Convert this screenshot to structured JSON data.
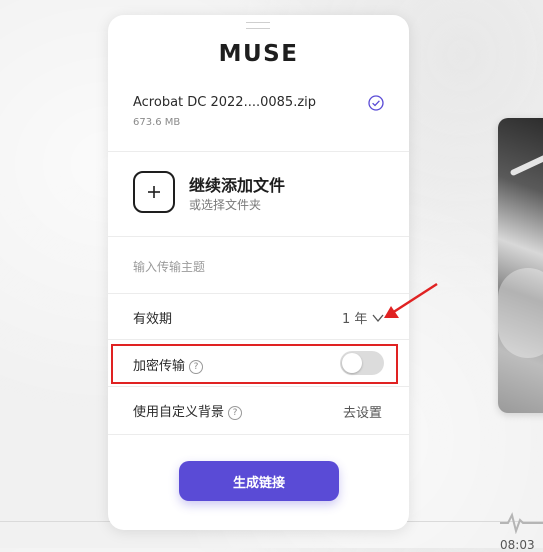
{
  "app": {
    "brand": "MUSE"
  },
  "file": {
    "name": "Acrobat DC 2022....0085.zip",
    "size": "673.6 MB",
    "status_icon": "check-circle-icon"
  },
  "add_files": {
    "icon": "plus-icon",
    "title": "继续添加文件",
    "subtitle": "或选择文件夹"
  },
  "subject": {
    "placeholder": "输入传输主题",
    "value": ""
  },
  "expiry": {
    "label": "有效期",
    "value": "1 年",
    "icon": "chevron-down-icon"
  },
  "encrypt": {
    "label": "加密传输",
    "help_icon": "question-circle-icon",
    "enabled": false
  },
  "custom_bg": {
    "label": "使用自定义背景",
    "help_icon": "question-circle-icon",
    "action": "去设置"
  },
  "generate": {
    "label": "生成链接"
  },
  "colors": {
    "accent": "#5a4bd6",
    "annotation": "#e02222",
    "check": "#5a4bd6"
  },
  "corner_text": "08:03"
}
